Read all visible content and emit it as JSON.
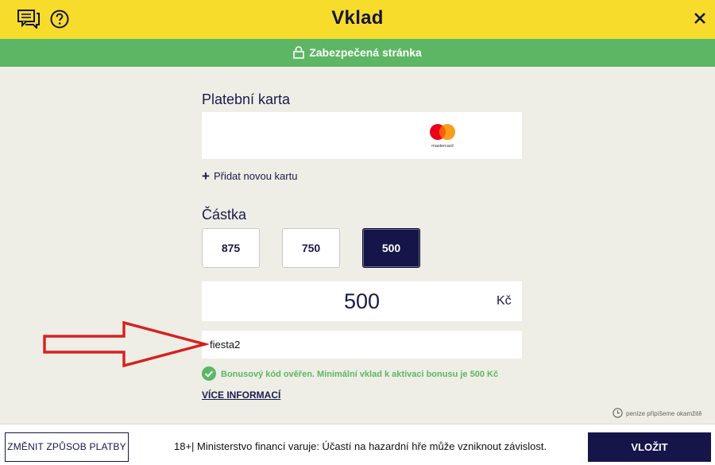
{
  "header": {
    "title": "Vklad",
    "secure_label": "Zabezpečená stránka"
  },
  "payment": {
    "section_label": "Platební karta",
    "card_brand": "mastercard",
    "add_card_label": "Přidat novou kartu"
  },
  "amount": {
    "section_label": "Částka",
    "presets": [
      "875",
      "750",
      "500"
    ],
    "selected": "500",
    "value": "500",
    "currency": "Kč"
  },
  "bonus": {
    "code": "fiesta2",
    "verified_message": "Bonusový kód ověřen. Minimální vklad k aktivaci bonusu je 500 Kč",
    "more_info_label": "VÍCE INFORMACÍ"
  },
  "instant_note": "peníze připíšeme okamžitě",
  "footer": {
    "change_method_label": "ZMĚNIT ZPŮSOB PLATBY",
    "warning": "18+| Ministerstvo financí varuje: Účastí na hazardní hře může vzniknout závislost.",
    "submit_label": "VLOŽIT"
  },
  "colors": {
    "header_yellow": "#f7dc2b",
    "secure_green": "#5db664",
    "navy": "#15154a",
    "background": "#eeeee6",
    "annotation_red": "#d62020"
  }
}
